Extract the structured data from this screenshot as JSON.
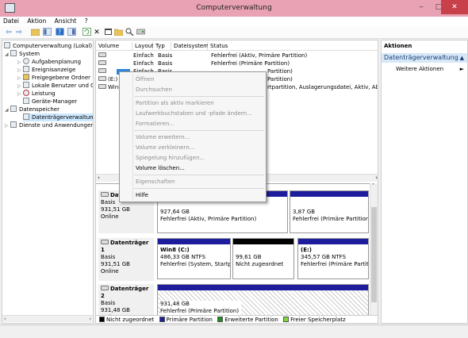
{
  "window": {
    "title": "Computerverwaltung",
    "minimize": "‒",
    "maximize": "□",
    "close": "✕"
  },
  "menu": [
    "Datei",
    "Aktion",
    "Ansicht",
    "?"
  ],
  "toolbar": {
    "back": "⇦",
    "forward": "⇨",
    "delete": "✕"
  },
  "tree": {
    "root": "Computerverwaltung (Lokal)",
    "system": "System",
    "aufgaben": "Aufgabenplanung",
    "ereignis": "Ereignisanzeige",
    "freigaben": "Freigegebene Ordner",
    "benutzer": "Lokale Benutzer und Gr",
    "leistung": "Leistung",
    "geraete": "Geräte-Manager",
    "datenspeicher": "Datenspeicher",
    "datentraeger": "Datenträgerverwaltung",
    "dienste": "Dienste und Anwendungen"
  },
  "volume_table": {
    "headers": {
      "volume": "Volume",
      "layout": "Layout",
      "typ": "Typ",
      "dateisystem": "Dateisystem",
      "status": "Status"
    },
    "rows": [
      {
        "volume": "",
        "layout": "Einfach",
        "typ": "Basis",
        "dateisystem": "",
        "status": "Fehlerfrei (Aktiv, Primäre Partition)"
      },
      {
        "volume": "",
        "layout": "Einfach",
        "typ": "Basis",
        "dateisystem": "",
        "status": "Fehlerfrei (Primäre Partition)"
      },
      {
        "volume": "",
        "layout": "Einfach",
        "typ": "Basis",
        "dateisystem": "",
        "status": "Partition)"
      },
      {
        "volume": "(E:)",
        "layout": "",
        "typ": "",
        "dateisystem": "",
        "status": "Partition)"
      },
      {
        "volume": "Win8",
        "layout": "",
        "typ": "",
        "dateisystem": "",
        "status": "rtpartition, Auslagerungsdatei, Aktiv, Absturz"
      }
    ]
  },
  "disks": [
    {
      "name": "Date",
      "type": "Basis",
      "size": "931,51 GB",
      "state": "Online",
      "partitions": [
        {
          "title": "",
          "size": "927,64 GB",
          "status": "Fehlerfrei (Aktiv, Primäre Partition)"
        },
        {
          "title": "",
          "size": "3,87 GB",
          "status": "Fehlerfrei (Primäre Partition)"
        }
      ]
    },
    {
      "name": "Datenträger 1",
      "type": "Basis",
      "size": "931,51 GB",
      "state": "Online",
      "partitions": [
        {
          "title": "Win8  (C:)",
          "size": "486,33 GB NTFS",
          "status": "Fehlerfrei (System, Startpar"
        },
        {
          "title": "",
          "size": "99,61 GB",
          "status": "Nicht zugeordnet"
        },
        {
          "title": "(E:)",
          "size": "345,57 GB NTFS",
          "status": "Fehlerfrei (Primäre Partitio"
        }
      ]
    },
    {
      "name": "Datenträger 2",
      "type": "Basis",
      "size": "931,48 GB",
      "state": "Online",
      "partitions": [
        {
          "title": "",
          "size": "931,48 GB",
          "status": "Fehlerfrei (Primäre Partition)"
        }
      ]
    }
  ],
  "legend": [
    {
      "label": "Nicht zugeordnet",
      "color": "#000000"
    },
    {
      "label": "Primäre Partition",
      "color": "#1c1c9c"
    },
    {
      "label": "Erweiterte Partition",
      "color": "#1e8c1e"
    },
    {
      "label": "Freier Speicherplatz",
      "color": "#7ddc3a"
    }
  ],
  "actions": {
    "header": "Aktionen",
    "section": "Datenträgerverwaltung",
    "more": "Weitere Aktionen",
    "section_arrow": "▲",
    "more_arrow": "►"
  },
  "context_menu": [
    {
      "label": "Öffnen",
      "enabled": false
    },
    {
      "label": "Durchsuchen",
      "enabled": false
    },
    {
      "label": "Partition als aktiv markieren",
      "enabled": false
    },
    {
      "label": "Laufwerkbuchstaben und -pfade ändern...",
      "enabled": false
    },
    {
      "label": "Formatieren...",
      "enabled": false
    },
    {
      "label": "Volume erweitern...",
      "enabled": false
    },
    {
      "label": "Volume verkleinern...",
      "enabled": false
    },
    {
      "label": "Spiegelung hinzufügen...",
      "enabled": false
    },
    {
      "label": "Volume löschen...",
      "enabled": true
    },
    {
      "label": "Eigenschaften",
      "enabled": false
    },
    {
      "label": "Hilfe",
      "enabled": true
    }
  ]
}
